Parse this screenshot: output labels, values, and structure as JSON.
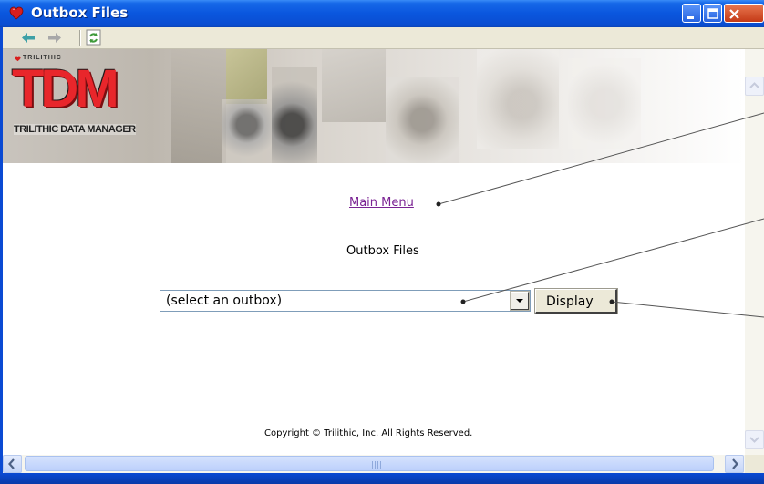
{
  "window": {
    "title": "Outbox Files",
    "controls": [
      "minimize",
      "maximize",
      "close"
    ]
  },
  "toolbar": {
    "buttons": [
      {
        "icon": "back-arrow-icon",
        "color": "#3da0a6"
      },
      {
        "icon": "forward-arrow-icon",
        "color": "#a8a8a8"
      },
      {
        "icon": "refresh-icon",
        "color": "#3f9a3b"
      }
    ]
  },
  "banner": {
    "brand_small": "TRILITHIC",
    "logo": "TDM",
    "subtitle": "TRILITHIC DATA MANAGER",
    "logo_color": "#e8262b"
  },
  "page": {
    "main_menu_link": "Main Menu",
    "heading": "Outbox Files",
    "outbox_select": {
      "selected": "(select an outbox)"
    },
    "display_button": "Display",
    "copyright": "Copyright © Trilithic, Inc. All Rights Reserved."
  },
  "colors": {
    "titlebar": "#0a56de",
    "link_visited": "#7a2293",
    "chrome": "#ece9d8"
  }
}
